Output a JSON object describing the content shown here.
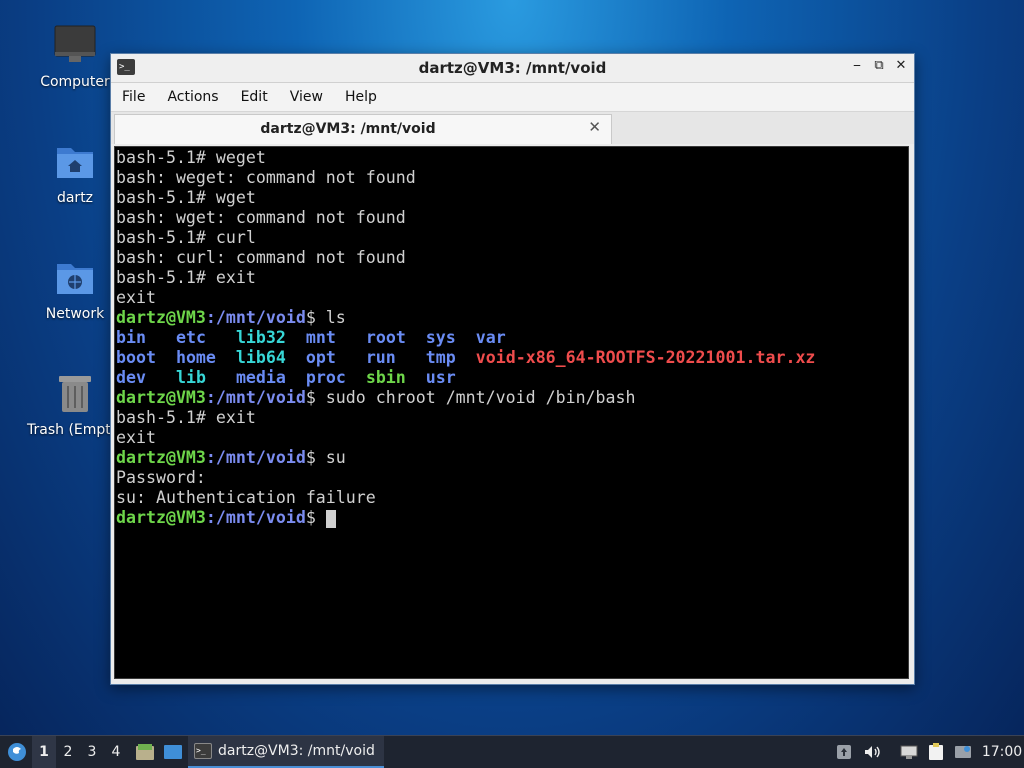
{
  "desktop": {
    "icons": [
      {
        "label": "Computer"
      },
      {
        "label": "dartz"
      },
      {
        "label": "Network"
      },
      {
        "label": "Trash (Empty)"
      }
    ]
  },
  "window": {
    "title": "dartz@VM3: /mnt/void",
    "menu": [
      "File",
      "Actions",
      "Edit",
      "View",
      "Help"
    ],
    "tab_label": "dartz@VM3: /mnt/void"
  },
  "terminal": {
    "prompt_user": "dartz@VM3",
    "prompt_path": ":/mnt/void",
    "lines": [
      "bash-5.1# weget",
      "bash: weget: command not found",
      "bash-5.1# wget",
      "bash: wget: command not found",
      "bash-5.1# curl",
      "bash: curl: command not found",
      "bash-5.1# exit",
      "exit",
      "$ ls",
      "bash-5.1# exit",
      "exit",
      "$ su",
      "Password:",
      "su: Authentication failure",
      "$ sudo chroot /mnt/void /bin/bash"
    ],
    "ls_items": {
      "bin": "bin",
      "etc": "etc",
      "lib32": "lib32",
      "mnt": "mnt",
      "root": "root",
      "sys": "sys",
      "var": "var",
      "boot": "boot",
      "home": "home",
      "lib64": "lib64",
      "opt": "opt",
      "run": "run",
      "tmp": "tmp",
      "archive": "void-x86_64-ROOTFS-20221001.tar.xz",
      "dev": "dev",
      "lib": "lib",
      "media": "media",
      "proc": "proc",
      "sbin": "sbin",
      "usr": "usr"
    },
    "prompt_end": "$ "
  },
  "taskbar": {
    "workspaces": [
      "1",
      "2",
      "3",
      "4"
    ],
    "task_label": "dartz@VM3: /mnt/void",
    "clock": "17:00"
  }
}
